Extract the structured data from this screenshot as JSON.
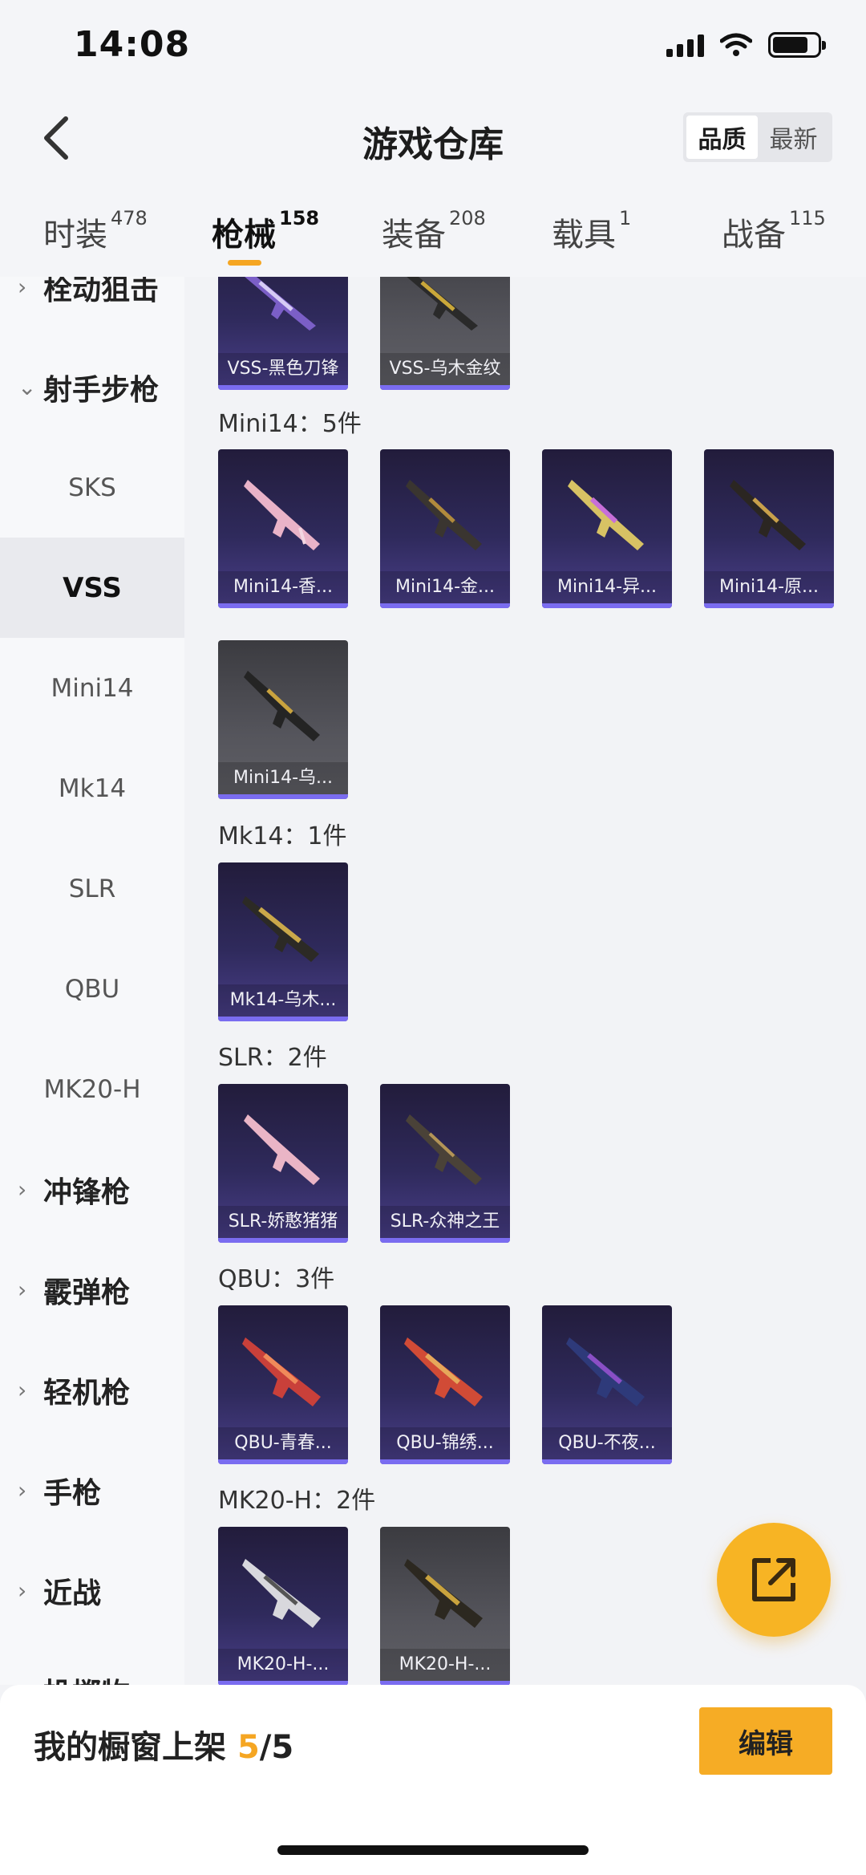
{
  "status": {
    "time": "14:08"
  },
  "header": {
    "title": "游戏仓库",
    "sort_options": [
      "品质",
      "最新"
    ]
  },
  "tabs": [
    {
      "label": "时装",
      "count": "478"
    },
    {
      "label": "枪械",
      "count": "158"
    },
    {
      "label": "装备",
      "count": "208"
    },
    {
      "label": "载具",
      "count": "1"
    },
    {
      "label": "战备",
      "count": "115"
    }
  ],
  "sidebar": {
    "groups": [
      "栓动狙击",
      "射手步枪",
      "冲锋枪",
      "霰弹枪",
      "轻机枪",
      "手枪",
      "近战",
      "投掷物"
    ],
    "subs": [
      "SKS",
      "VSS",
      "Mini14",
      "Mk14",
      "SLR",
      "QBU",
      "MK20-H"
    ],
    "chevron_right": "›",
    "chevron_down": "⌄"
  },
  "sections": [
    {
      "title": "",
      "items": [
        "VSS-黑色刀锋",
        "VSS-乌木金纹"
      ]
    },
    {
      "title": "Mini14：5件",
      "items": [
        "Mini14-香...",
        "Mini14-金...",
        "Mini14-异...",
        "Mini14-原...",
        "Mini14-乌..."
      ]
    },
    {
      "title": "Mk14：1件",
      "items": [
        "Mk14-乌木..."
      ]
    },
    {
      "title": "SLR：2件",
      "items": [
        "SLR-娇憨猪猪",
        "SLR-众神之王"
      ]
    },
    {
      "title": "QBU：3件",
      "items": [
        "QBU-青春...",
        "QBU-锦绣...",
        "QBU-不夜..."
      ]
    },
    {
      "title": "MK20-H：2件",
      "items": [
        "MK20-H-...",
        "MK20-H-..."
      ]
    }
  ],
  "bottom": {
    "showcase_label": "我的橱窗上架",
    "count": "5",
    "total": "/5",
    "edit_label": "编辑"
  },
  "colors": {
    "accent": "#f5a623",
    "card_purple": "#2f2a5c",
    "card_gray": "#55555c"
  }
}
